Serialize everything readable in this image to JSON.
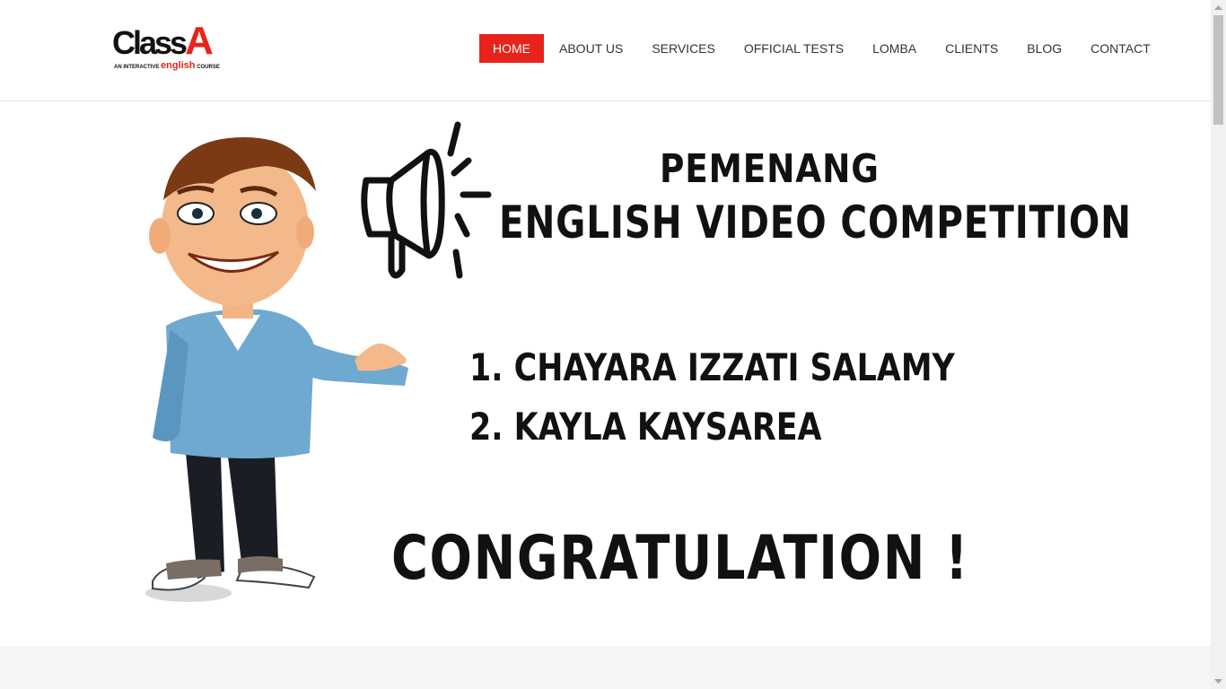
{
  "brand": {
    "logo_main": "Class",
    "logo_a": "A",
    "logo_tag_pre": "AN INTERACTIVE",
    "logo_tag_eng": "english",
    "logo_tag_post": "COURSE",
    "accent_color": "#e8231a"
  },
  "nav": {
    "items": [
      {
        "label": "HOME",
        "active": true
      },
      {
        "label": "ABOUT US"
      },
      {
        "label": "SERVICES"
      },
      {
        "label": "OFFICIAL TESTS"
      },
      {
        "label": "LOMBA"
      },
      {
        "label": "CLIENTS"
      },
      {
        "label": "BLOG"
      },
      {
        "label": "CONTACT"
      }
    ]
  },
  "banner": {
    "title_line1": "PEMENANG",
    "title_line2": "ENGLISH VIDEO COMPETITION",
    "winner1": "1. CHAYARA IZZATI SALAMY",
    "winner2": "2. KAYLA KAYSAREA",
    "congrats": "CONGRATULATION !",
    "icons": [
      "megaphone-icon",
      "cartoon-man-illustration"
    ]
  }
}
